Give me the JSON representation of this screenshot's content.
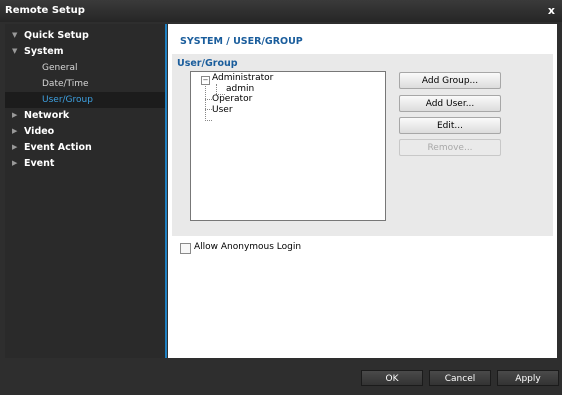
{
  "window": {
    "title": "Remote Setup",
    "close_label": "x"
  },
  "sidebar": {
    "items": [
      {
        "label": "Quick Setup",
        "arrow": "▼"
      },
      {
        "label": "System",
        "arrow": "▼",
        "children": [
          {
            "label": "General"
          },
          {
            "label": "Date/Time"
          },
          {
            "label": "User/Group",
            "selected": true
          }
        ]
      },
      {
        "label": "Network",
        "arrow": "▶"
      },
      {
        "label": "Video",
        "arrow": "▶"
      },
      {
        "label": "Event Action",
        "arrow": "▶"
      },
      {
        "label": "Event",
        "arrow": "▶"
      }
    ]
  },
  "main": {
    "header": "SYSTEM / USER/GROUP",
    "group_title": "User/Group",
    "tree": {
      "expander": "−",
      "nodes": [
        {
          "label": "Administrator",
          "children": [
            {
              "label": "admin"
            }
          ]
        },
        {
          "label": "Operator"
        },
        {
          "label": "User"
        }
      ]
    },
    "buttons": {
      "add_group": "Add Group...",
      "add_user": "Add User...",
      "edit": "Edit...",
      "remove": "Remove..."
    },
    "allow_anonymous": {
      "label": "Allow Anonymous Login",
      "checked": false
    }
  },
  "footer": {
    "ok": "OK",
    "cancel": "Cancel",
    "apply": "Apply"
  },
  "colors": {
    "accent": "#1e7fc0",
    "header_text": "#1a5d9c",
    "selected_text": "#3ea0e0"
  }
}
